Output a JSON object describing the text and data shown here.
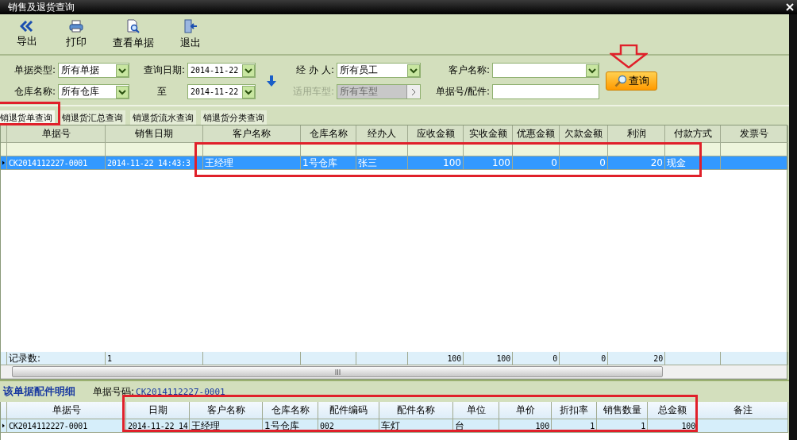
{
  "window": {
    "title": "销售及退货查询"
  },
  "toolbar": [
    {
      "label": "导出",
      "kind": "export"
    },
    {
      "label": "打印",
      "kind": "print"
    },
    {
      "label": "查看单据",
      "kind": "view"
    },
    {
      "label": "退出",
      "kind": "exit"
    }
  ],
  "filters": [
    [
      {
        "label": "单据类型:",
        "value": "所有单据",
        "kind": "select",
        "disabled": false
      },
      {
        "label": "查询日期:",
        "value": "2014-11-22",
        "kind": "date",
        "disabled": false
      },
      {
        "label": "经 办 人:",
        "value": "所有员工",
        "kind": "select",
        "disabled": false
      },
      {
        "label": "客户名称:",
        "kind": "select",
        "disabled": false
      }
    ],
    [
      {
        "label": "仓库名称:",
        "value": "所有仓库",
        "kind": "select",
        "disabled": false
      },
      {
        "label": "至",
        "value": "2014-11-22",
        "kind": "date",
        "disabled": false
      },
      {
        "label": "适用车型:",
        "value": "所有车型",
        "kind": "picker",
        "disabled": true
      },
      {
        "label": "单据号/配件:",
        "kind": "text",
        "disabled": false
      }
    ]
  ],
  "query_button": {
    "label": "查询"
  },
  "tabs": [
    {
      "label": "销退货单查询",
      "selected": true
    },
    {
      "label": "销退货汇总查询",
      "selected": false
    },
    {
      "label": "销退货流水查询",
      "selected": false
    },
    {
      "label": "销退货分类查询",
      "selected": false
    }
  ],
  "table": {
    "columns": [
      "单据号",
      "销售日期",
      "客户名称",
      "仓库名称",
      "经办人",
      "应收金额",
      "实收金额",
      "优惠金额",
      "欠款金额",
      "利润",
      "付款方式",
      "发票号"
    ],
    "rows": [
      {
        "selected": true,
        "cells": [
          "CK2014112227-0001",
          "2014-11-22 14:43:3",
          "王经理",
          "1号仓库",
          "张三",
          "100",
          "100",
          "0",
          "0",
          "20",
          "现金"
        ]
      }
    ],
    "totals": {
      "label": "记录数:",
      "count": "1",
      "receivable": "100",
      "received": "100",
      "discount": "0",
      "owed": "0",
      "profit": "20"
    }
  },
  "detail": {
    "title": "该单据配件明细",
    "number_label": "单据号码:",
    "number": "CK2014112227-0001",
    "columns": [
      "单据号",
      "日期",
      "客户名称",
      "仓库名称",
      "配件编码",
      "配件名称",
      "单位",
      "单价",
      "折扣率",
      "销售数量",
      "总金额",
      "备注"
    ],
    "rows": [
      {
        "selected": false,
        "cells": [
          "CK2014112227-0001",
          "2014-11-22 14",
          "王经理",
          "1号仓库",
          "002",
          "车灯",
          "台",
          "100",
          "1",
          "1",
          "100"
        ]
      }
    ]
  }
}
